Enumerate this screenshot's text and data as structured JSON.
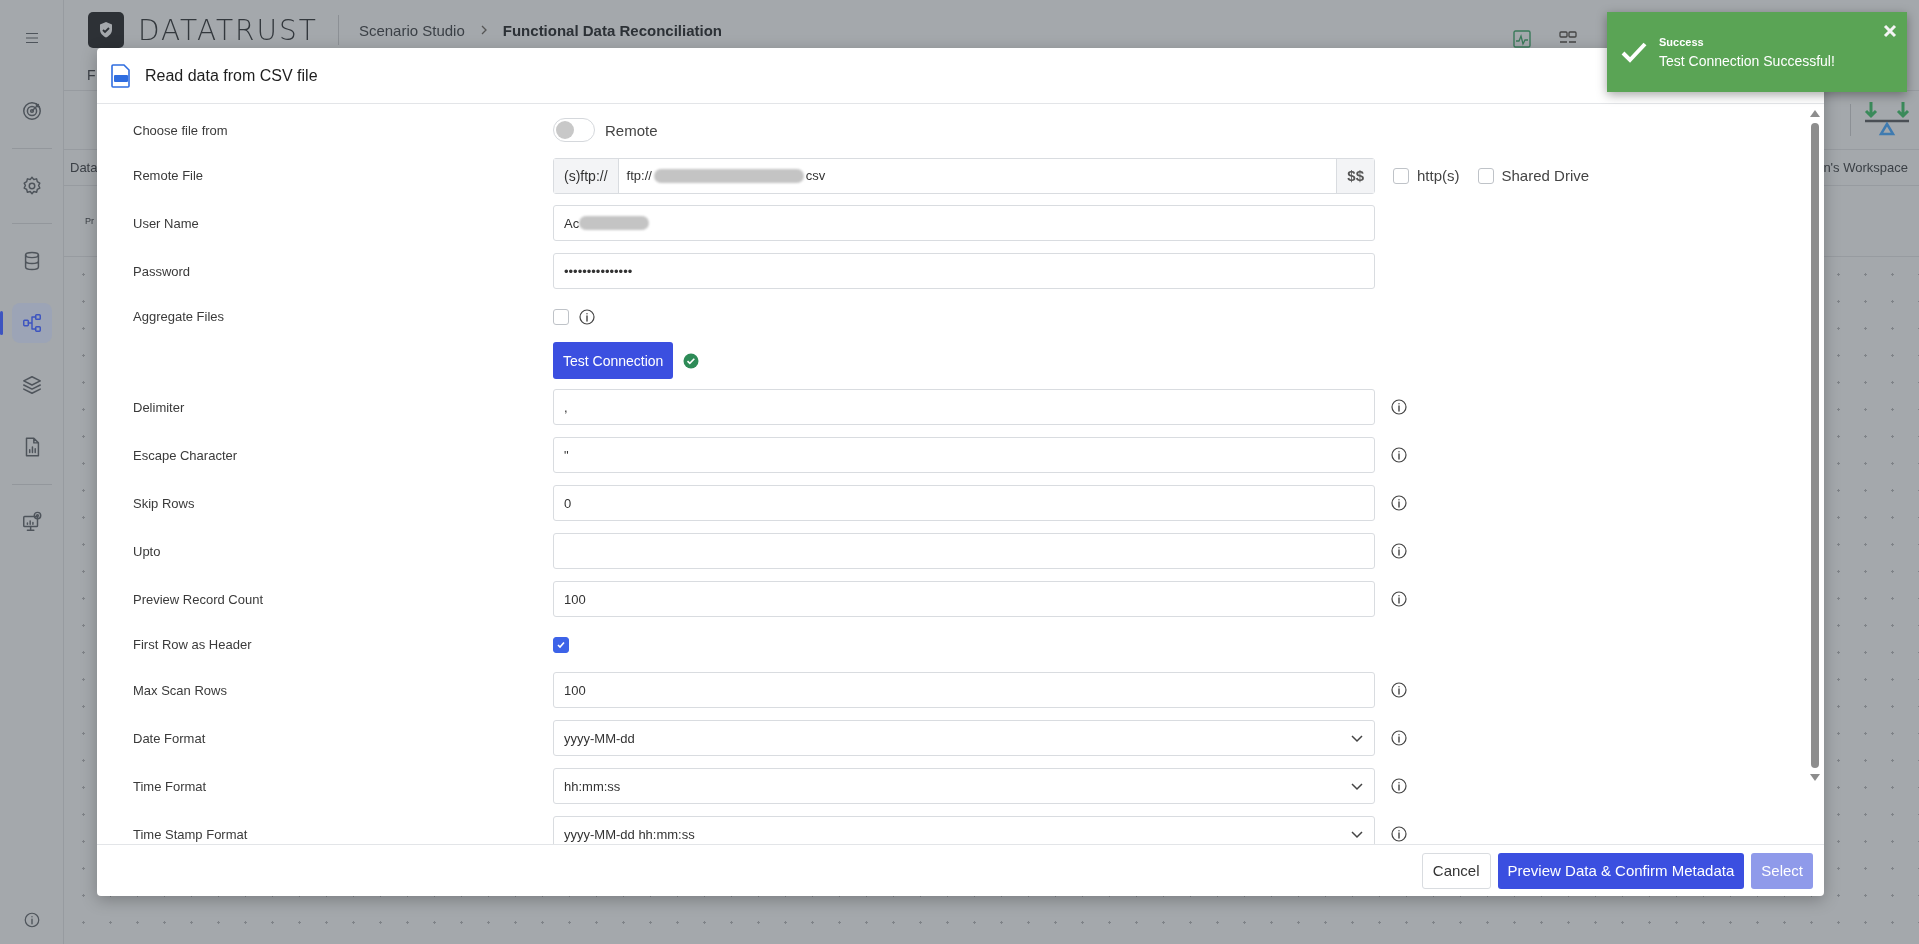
{
  "sidebar": {
    "groups": [
      [
        {
          "kind": "target",
          "selected": false
        }
      ],
      [
        {
          "kind": "gear",
          "selected": false
        }
      ],
      [
        {
          "kind": "database",
          "selected": false
        },
        {
          "kind": "flow",
          "selected": true
        },
        {
          "kind": "layers",
          "selected": false
        },
        {
          "kind": "report",
          "selected": false
        }
      ],
      [
        {
          "kind": "monitor",
          "selected": false
        }
      ]
    ]
  },
  "header": {
    "brand": "DATATRUST",
    "breadcrumb": [
      {
        "label": "Scenario Studio",
        "current": false
      },
      {
        "label": "Functional Data Reconciliation",
        "current": true
      }
    ]
  },
  "background": {
    "tab_fragment": "F",
    "subtab_fragment": "Data",
    "row_fragment": "Pr",
    "workspace_fragment": "n's Workspace"
  },
  "dialog": {
    "title": "Read data from CSV file",
    "rows": [
      {
        "kind": "toggle",
        "label": "Choose file from",
        "option": "Remote",
        "on": false
      },
      {
        "kind": "remote",
        "label": "Remote File",
        "prefix": "(s)ftp://",
        "value_start": "ftp://",
        "value_end": "csv",
        "redacted": true,
        "suffix": "$$",
        "options": [
          {
            "label": "http(s)",
            "checked": false
          },
          {
            "label": "Shared Drive",
            "checked": false
          }
        ]
      },
      {
        "kind": "text",
        "label": "User Name",
        "value": "Ac",
        "redacted": true,
        "info": false
      },
      {
        "kind": "text",
        "label": "Password",
        "value": "•••••••••••••••",
        "redacted": false,
        "info": false
      },
      {
        "kind": "checkbox",
        "label": "Aggregate Files",
        "checked": false,
        "info": true
      },
      {
        "kind": "action",
        "button": "Test Connection",
        "verified": true
      },
      {
        "kind": "text",
        "label": "Delimiter",
        "value": ",",
        "redacted": false,
        "info": true
      },
      {
        "kind": "text",
        "label": "Escape Character",
        "value": "\"",
        "redacted": false,
        "info": true
      },
      {
        "kind": "text",
        "label": "Skip Rows",
        "value": "0",
        "redacted": false,
        "info": true
      },
      {
        "kind": "text",
        "label": "Upto",
        "redacted": false,
        "info": true
      },
      {
        "kind": "text",
        "label": "Preview Record Count",
        "value": "100",
        "redacted": false,
        "info": true
      },
      {
        "kind": "checkbox",
        "label": "First Row as Header",
        "checked": true,
        "info": false
      },
      {
        "kind": "text",
        "label": "Max Scan Rows",
        "value": "100",
        "redacted": false,
        "info": true
      },
      {
        "kind": "select",
        "label": "Date Format",
        "value": "yyyy-MM-dd",
        "info": true
      },
      {
        "kind": "select",
        "label": "Time Format",
        "value": "hh:mm:ss",
        "info": true
      },
      {
        "kind": "select",
        "label": "Time Stamp Format",
        "value": "yyyy-MM-dd hh:mm:ss",
        "info": true
      }
    ],
    "buttons": [
      {
        "label": "Cancel",
        "kind": "secondary",
        "disabled": false
      },
      {
        "label": "Preview Data & Confirm Metadata",
        "kind": "primary",
        "disabled": false
      },
      {
        "label": "Select",
        "kind": "primary",
        "disabled": true
      }
    ]
  },
  "toast": {
    "title": "Success",
    "message": "Test Connection Successful!"
  }
}
